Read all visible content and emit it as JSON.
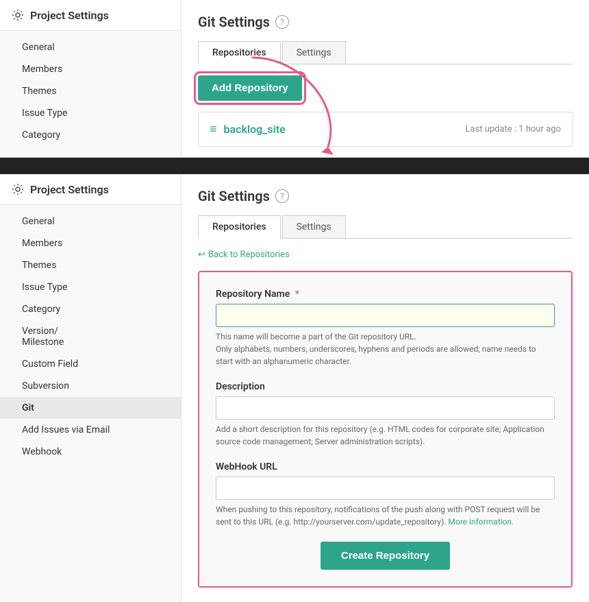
{
  "top_sidebar": {
    "title": "Project Settings",
    "nav_items": [
      {
        "label": "General",
        "active": false
      },
      {
        "label": "Members",
        "active": false
      },
      {
        "label": "Themes",
        "active": false
      },
      {
        "label": "Issue Type",
        "active": false
      },
      {
        "label": "Category",
        "active": false
      }
    ]
  },
  "bottom_sidebar": {
    "title": "Project Settings",
    "nav_items": [
      {
        "label": "General",
        "active": false
      },
      {
        "label": "Members",
        "active": false
      },
      {
        "label": "Themes",
        "active": false
      },
      {
        "label": "Issue Type",
        "active": false
      },
      {
        "label": "Category",
        "active": false
      },
      {
        "label": "Version/\nMilestone",
        "active": false
      },
      {
        "label": "Custom Field",
        "active": false
      },
      {
        "label": "Subversion",
        "active": false
      },
      {
        "label": "Git",
        "active": true
      },
      {
        "label": "Add Issues via Email",
        "active": false
      },
      {
        "label": "Webhook",
        "active": false
      }
    ]
  },
  "top_section": {
    "git_settings_title": "Git Settings",
    "tabs": [
      {
        "label": "Repositories",
        "active": true
      },
      {
        "label": "Settings",
        "active": false
      }
    ],
    "add_repository_label": "Add Repository",
    "repo": {
      "name": "backlog_site",
      "last_update": "Last update : 1 hour ago"
    }
  },
  "bottom_section": {
    "git_settings_title": "Git Settings",
    "tabs": [
      {
        "label": "Repositories",
        "active": true
      },
      {
        "label": "Settings",
        "active": false
      }
    ],
    "back_link": "Back to Repositories",
    "form": {
      "repo_name_label": "Repository Name",
      "repo_name_hint_1": "This name will become a part of the Git repository URL.",
      "repo_name_hint_2": "Only alphabets, numbers, underscores, hyphens and periods are allowed; name needs to start with an alphanumeric character.",
      "description_label": "Description",
      "description_placeholder": "",
      "description_hint": "Add a short description for this repository (e.g. HTML codes for corporate site; Application source code management; Server administration scripts).",
      "webhook_url_label": "WebHook URL",
      "webhook_url_placeholder": "",
      "webhook_hint_1": "When pushing to this repository, notifications of the push along with POST request will be sent to this URL (e.g. http://yourserver.com/update_repository).",
      "webhook_hint_link": "More information.",
      "create_button_label": "Create Repository"
    }
  }
}
